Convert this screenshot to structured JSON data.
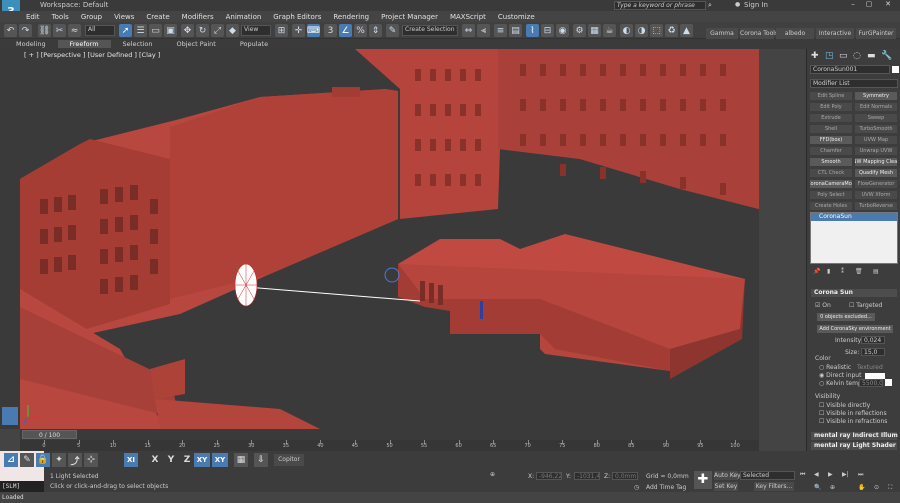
{
  "titlebar": {
    "workspace": "Workspace: Default",
    "search_placeholder": "Type a keyword or phrase",
    "sign_in": "Sign In"
  },
  "menu": [
    "Edit",
    "Tools",
    "Group",
    "Views",
    "Create",
    "Modifiers",
    "Animation",
    "Graph Editors",
    "Rendering",
    "Project Manager",
    "MAXScript",
    "Customize"
  ],
  "toolbar": {
    "filter": "All",
    "view": "View",
    "selection_set": "Create Selection Se",
    "shelf_tabs": [
      "Gamma",
      "Corona Tools",
      "albedo",
      "Interactive",
      "FurGPainter"
    ]
  },
  "ribbon_tabs": [
    "Modeling",
    "Freeform",
    "Selection",
    "Object Paint",
    "Populate"
  ],
  "viewport": {
    "label": "[ + ] [Perspective ] [User Defined ] [Clay ]"
  },
  "command_panel": {
    "object_name": "CoronaSun001",
    "modifier_list": "Modifier List",
    "modifiers": [
      [
        "Edit Spline",
        "Symmetry"
      ],
      [
        "Edit Poly",
        "Edit Normals"
      ],
      [
        "Extrude",
        "Sweep"
      ],
      [
        "Shell",
        "TurboSmooth"
      ],
      [
        "FFD(box)",
        "UVW Map"
      ],
      [
        "Chamfer",
        "Unwrap UVW"
      ],
      [
        "Smooth",
        "NW Mapping Clear"
      ],
      [
        "CTL Check",
        "Quadify Mesh"
      ],
      [
        "CoronaCameraMod",
        "FlowGenerator"
      ],
      [
        "Poly Select",
        "UVW Xform"
      ],
      [
        "Create Holes",
        "TurboReverse"
      ]
    ],
    "stack_item": "CoronaSun",
    "sun": {
      "rollout": "Corona Sun",
      "on": "On",
      "targeted": "Targeted",
      "excluded": "0 objects excluded...",
      "add_env": "Add CoronaSky environment",
      "intensity_label": "Intensity:",
      "intensity": "0,024",
      "size_label": "Size:",
      "size": "15,0",
      "color_label": "Color",
      "realistic": "Realistic",
      "textured": "Textured",
      "direct_input": "Direct input",
      "kelvin": "Kelvin temp",
      "kelvin_value": "5500,0",
      "visibility_label": "Visibility",
      "vis_directly": "Visible directly",
      "vis_reflections": "Visible in reflections",
      "vis_refractions": "Visible in refractions"
    },
    "rollout_mr_indirect": "mental ray Indirect Illum",
    "rollout_mr_shader": "mental ray Light Shader"
  },
  "timeline": {
    "frame": "0 / 100",
    "ticks": [
      "0",
      "5",
      "10",
      "15",
      "20",
      "25",
      "30",
      "35",
      "40",
      "45",
      "50",
      "55",
      "60",
      "65",
      "70",
      "75",
      "80",
      "85",
      "90",
      "95",
      "100"
    ]
  },
  "bottom": {
    "axes": [
      "X",
      "Y",
      "Z",
      "XY",
      "XY"
    ],
    "copitor": "Copitor",
    "status_1": "1 Light Selected",
    "status_2": "Click or click-and-drag to select objects",
    "script_label": "[SLM] Loaded",
    "x_label": "X:",
    "x_val": "-946,223",
    "y_label": "Y:",
    "y_val": "-1031,4x",
    "z_label": "Z:",
    "z_val": "0,0mm",
    "grid": "Grid = 0,0mm",
    "add_time_tag": "Add Time Tag",
    "auto_key": "Auto Key",
    "set_key": "Set Key",
    "selected": "Selected",
    "key_filters": "Key Filters..."
  },
  "colors": {
    "building": "#b8473f",
    "accent": "#4a7bb0",
    "ground": "#3a3a3a"
  }
}
